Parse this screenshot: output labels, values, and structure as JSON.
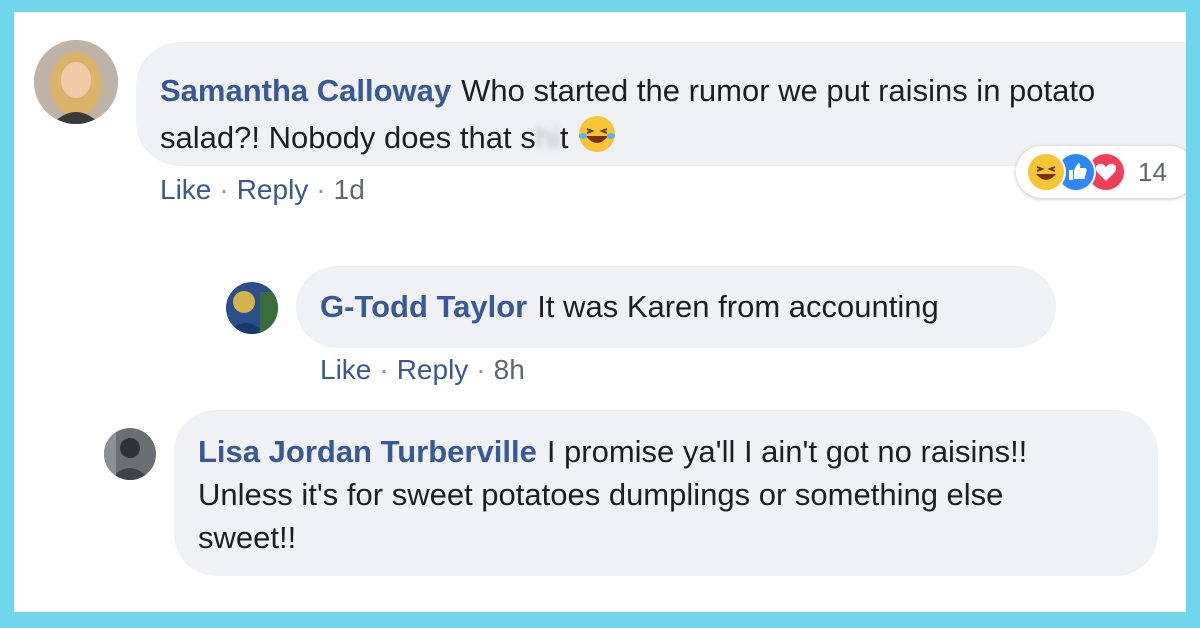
{
  "comments": [
    {
      "author": "Samantha Calloway",
      "text_before": "Who started the rumor we put raisins in potato salad?! Nobody does that s",
      "text_censored": "hi",
      "text_after": "t ",
      "emoji": "laughing-tears-emoji",
      "actions": {
        "like": "Like",
        "reply": "Reply",
        "time": "1d"
      },
      "reactions": {
        "icons": [
          "haha-icon",
          "like-icon",
          "love-icon"
        ],
        "count": "14"
      }
    },
    {
      "author": "G-Todd Taylor",
      "text": "It was Karen from accounting",
      "actions": {
        "like": "Like",
        "reply": "Reply",
        "time": "8h"
      }
    },
    {
      "author": "Lisa Jordan Turberville",
      "text": "I promise ya'll I ain't got no raisins!! Unless it's for sweet potatoes dumplings or something else sweet!!"
    }
  ],
  "separator": "·",
  "colors": {
    "border": "#6fd6ec",
    "bubble": "#eff1f4",
    "author": "#385898",
    "meta": "#606770"
  }
}
